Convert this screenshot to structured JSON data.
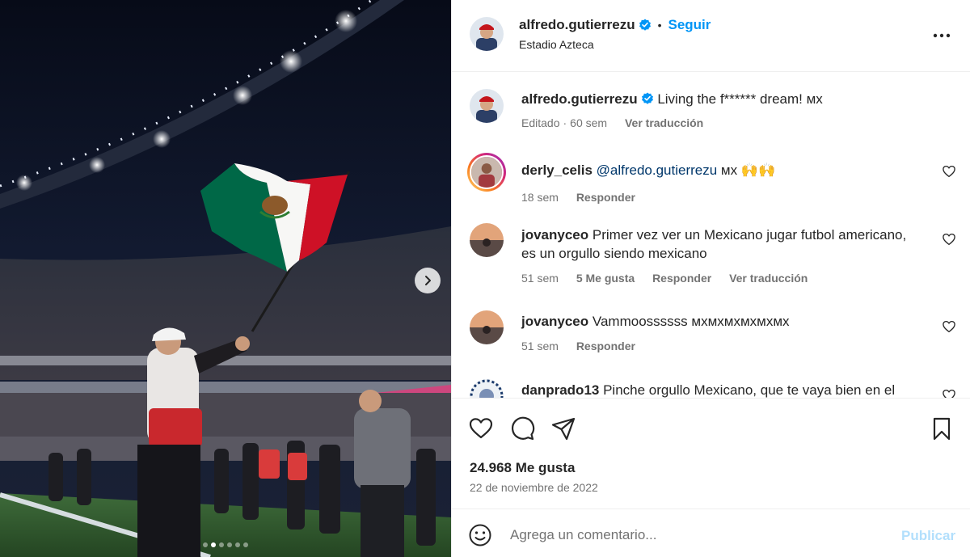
{
  "post": {
    "username": "alfredo.gutierrezu",
    "verified": true,
    "separator": "•",
    "follow_label": "Seguir",
    "location": "Estadio Azteca",
    "more_icon": "more-horizontal-icon",
    "image_carousel": {
      "dots": 6,
      "active_index": 1
    }
  },
  "caption": {
    "username": "alfredo.gutierrezu",
    "text": "Living the f****** dream! ᴍx",
    "edited": "Editado",
    "time": "60 sem",
    "translate": "Ver traducción"
  },
  "comments": [
    {
      "username": "derly_celis",
      "mention": "@alfredo.gutierrezu",
      "text": " ᴍx 🙌🙌",
      "time": "18 sem",
      "reply": "Responder"
    },
    {
      "username": "jovanyceo",
      "mention": "",
      "text": "Primer vez ver un Mexicano jugar futbol americano, es un orgullo siendo mexicano",
      "time": "51 sem",
      "likes": "5 Me gusta",
      "reply": "Responder",
      "translate": "Ver traducción"
    },
    {
      "username": "jovanyceo",
      "mention": "",
      "text": "Vammoossssss ᴍxᴍxᴍxᴍxᴍxᴍx",
      "time": "51 sem",
      "reply": "Responder"
    },
    {
      "username": "danprado13",
      "mention": "",
      "text": "Pinche orgullo Mexicano, que te vaya bien en el"
    }
  ],
  "actions": {
    "like_icon": "heart-icon",
    "comment_icon": "comment-icon",
    "share_icon": "share-icon",
    "save_icon": "bookmark-icon"
  },
  "stats": {
    "likes": "24.968 Me gusta",
    "date": "22 de noviembre de 2022"
  },
  "composer": {
    "emoji_icon": "emoji-icon",
    "placeholder": "Agrega un comentario...",
    "publish_label": "Publicar"
  },
  "colors": {
    "link_blue": "#0095f6",
    "mention_blue": "#00376b",
    "muted_text": "#737373",
    "publish_disabled": "#b2dffc",
    "flag_green": "#006847",
    "flag_red": "#ce1126"
  }
}
